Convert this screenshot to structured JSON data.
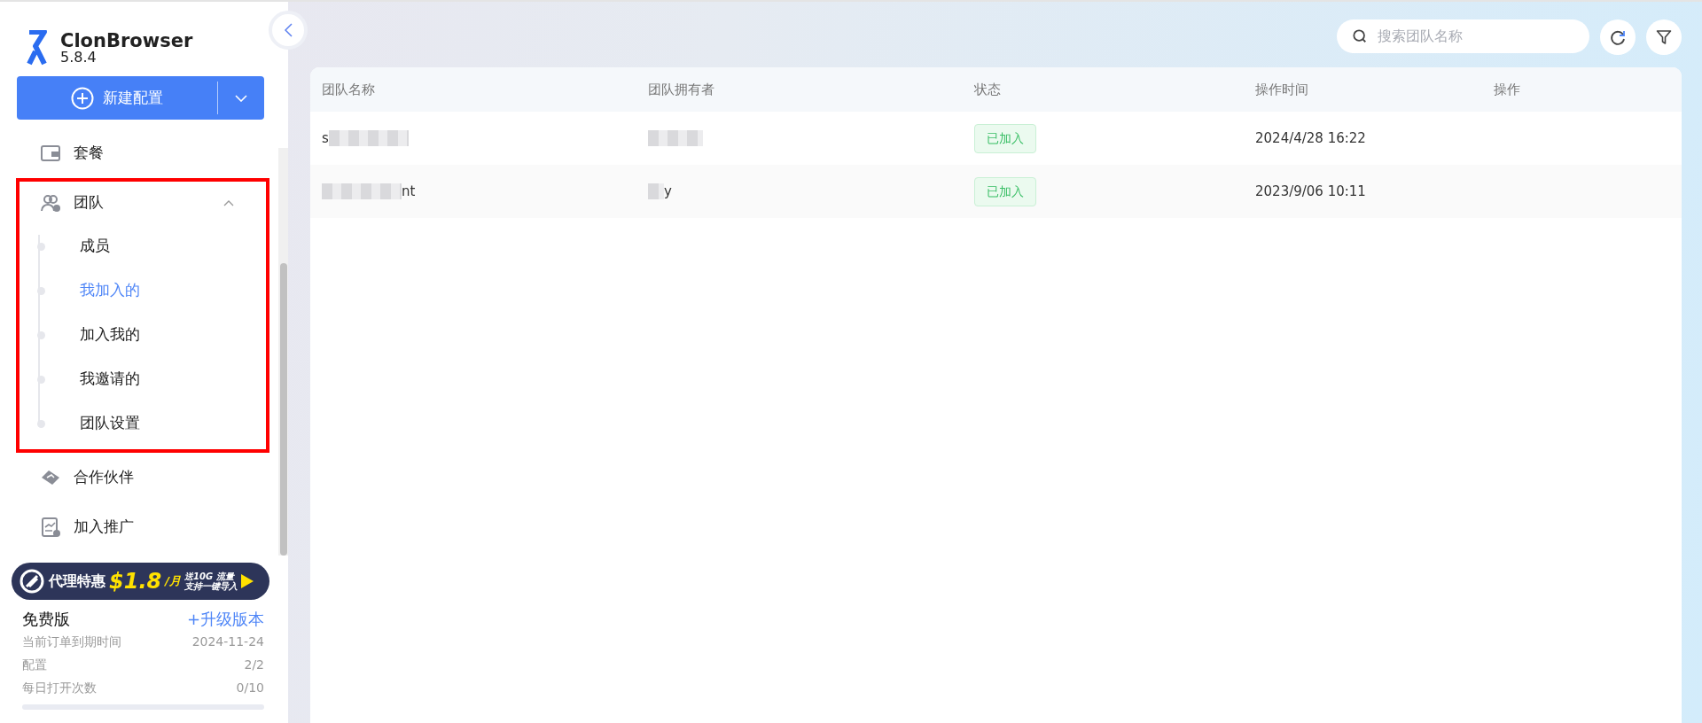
{
  "app": {
    "name": "ClonBrowser",
    "version": "5.8.4"
  },
  "new_button": {
    "label": "新建配置"
  },
  "sidebar": {
    "items": [
      {
        "kind": "item",
        "label": "套餐",
        "selected": false
      },
      {
        "kind": "group",
        "label": "团队",
        "expanded": true,
        "highlighted": true,
        "children": [
          {
            "label": "成员",
            "selected": false
          },
          {
            "label": "我加入的",
            "selected": true
          },
          {
            "label": "加入我的",
            "selected": false
          },
          {
            "label": "我邀请的",
            "selected": false
          },
          {
            "label": "团队设置",
            "selected": false
          }
        ]
      },
      {
        "kind": "item",
        "label": "合作伙伴",
        "selected": false
      },
      {
        "kind": "item",
        "label": "加入推广",
        "selected": false
      }
    ]
  },
  "promo": {
    "title": "代理特惠",
    "price": "$1.8",
    "unit": "/月",
    "line_1": "送10G 流量",
    "line_2": "支持一键导入"
  },
  "plan": {
    "name": "免费版",
    "upgrade": "+升级版本",
    "rows": [
      {
        "label": "当前订单到期时间",
        "value": "2024-11-24"
      },
      {
        "label": "配置",
        "value": "2/2"
      },
      {
        "label": "每日打开次数",
        "value": "0/10"
      }
    ],
    "level": 0
  },
  "search": {
    "placeholder": "搜索团队名称"
  },
  "table": {
    "columns": [
      "团队名称",
      "团队拥有者",
      "状态",
      "操作时间",
      "操作"
    ],
    "rows": [
      {
        "name": "s",
        "status": "已加入",
        "time": "2024/4/28 16:22"
      },
      {
        "name": "nt",
        "owner": "y",
        "status": "已加入",
        "time": "2023/9/06 10:11"
      }
    ]
  }
}
